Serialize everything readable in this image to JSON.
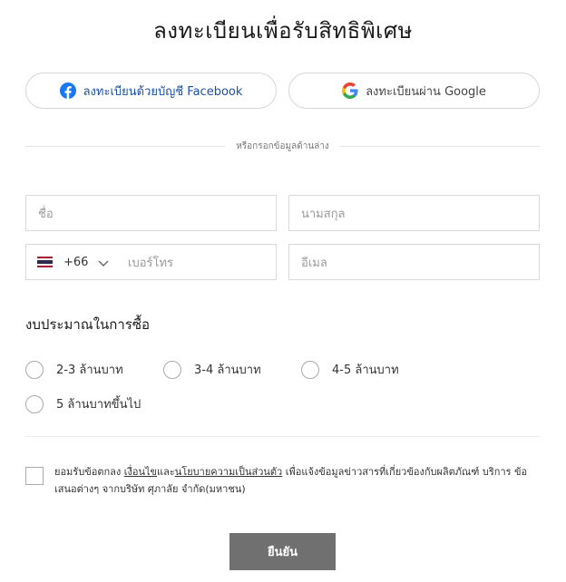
{
  "title": "ลงทะเบียนเพื่อรับสิทธิพิเศษ",
  "social": {
    "facebook_label": "ลงทะเบียนด้วยบัญชี Facebook",
    "google_label": "ลงทะเบียนผ่าน Google"
  },
  "divider_text": "หรือกรอกข้อมูลด้านล่าง",
  "fields": {
    "first_name_placeholder": "ชื่อ",
    "last_name_placeholder": "นามสกุล",
    "country_code": "+66",
    "phone_placeholder": "เบอร์โทร",
    "email_placeholder": "อีเมล"
  },
  "budget": {
    "title": "งบประมาณในการซื้อ",
    "options": [
      "2-3 ล้านบาท",
      "3-4 ล้านบาท",
      "4-5 ล้านบาท",
      "5 ล้านบาทขึ้นไป"
    ]
  },
  "consent": {
    "prefix": "ยอมรับข้อตกลง ",
    "terms_link": "เงื่อนไข",
    "and": "และ",
    "privacy_link": "นโยบายความเป็นส่วนตัว",
    "suffix": " เพื่อแจ้งข้อมูลข่าวสารที่เกี่ยวข้องกับผลิตภัณฑ์ บริการ ข้อเสนอต่างๆ จากบริษัท ศุภาลัย จำกัด(มหาชน)"
  },
  "submit_label": "ยืนยัน",
  "colors": {
    "facebook": "#1877F2",
    "facebook_text": "#1c4fa3",
    "submit_bg": "#707070"
  }
}
